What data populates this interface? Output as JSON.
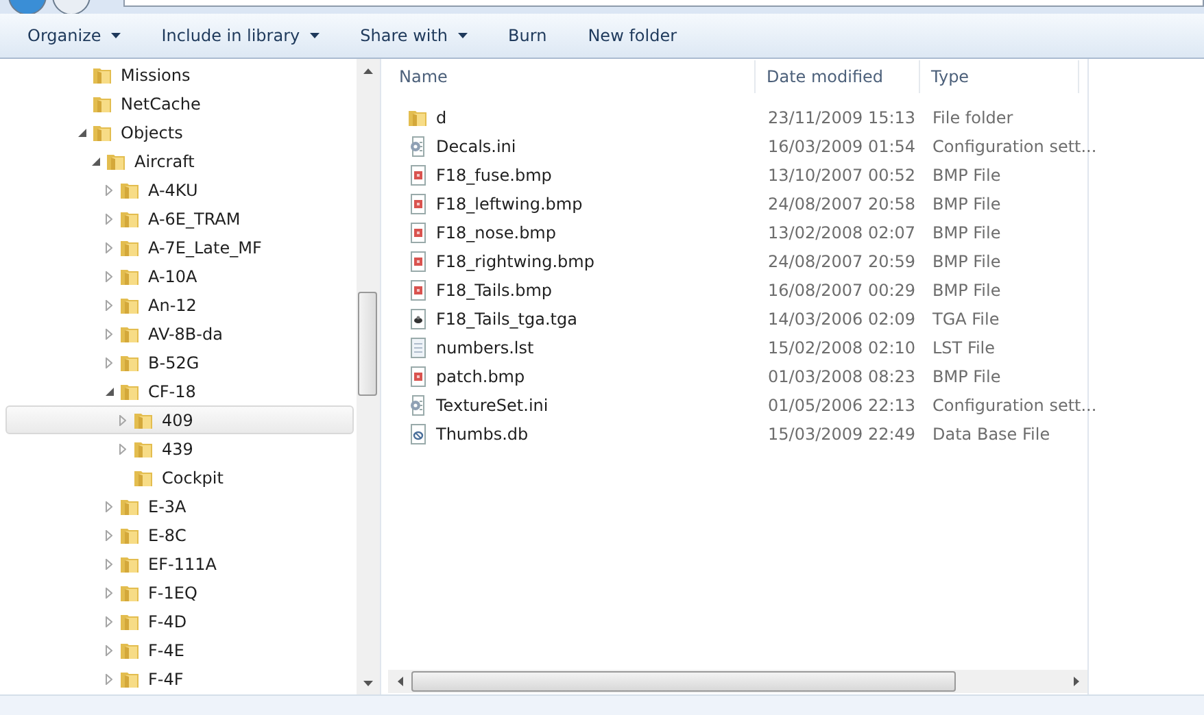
{
  "toolbar": [
    {
      "label": "Organize",
      "dropdown": true
    },
    {
      "label": "Include in library",
      "dropdown": true
    },
    {
      "label": "Share with",
      "dropdown": true
    },
    {
      "label": "Burn",
      "dropdown": false
    },
    {
      "label": "New folder",
      "dropdown": false
    }
  ],
  "tree": [
    {
      "label": "Missions",
      "selected": false
    },
    {
      "label": "NetCache",
      "selected": false
    },
    {
      "label": "Objects",
      "selected": false,
      "expanded": true,
      "children": [
        {
          "label": "Aircraft",
          "selected": false,
          "expanded": true,
          "children": [
            {
              "label": "A-4KU",
              "selected": false,
              "expanded": false
            },
            {
              "label": "A-6E_TRAM",
              "selected": false,
              "expanded": false
            },
            {
              "label": "A-7E_Late_MF",
              "selected": false,
              "expanded": false
            },
            {
              "label": "A-10A",
              "selected": false,
              "expanded": false
            },
            {
              "label": "An-12",
              "selected": false,
              "expanded": false
            },
            {
              "label": "AV-8B-da",
              "selected": false,
              "expanded": false
            },
            {
              "label": "B-52G",
              "selected": false,
              "expanded": false
            },
            {
              "label": "CF-18",
              "selected": false,
              "expanded": true,
              "children": [
                {
                  "label": "409",
                  "selected": true,
                  "expanded": false
                },
                {
                  "label": "439",
                  "selected": false,
                  "expanded": false
                },
                {
                  "label": "Cockpit",
                  "selected": false
                }
              ]
            },
            {
              "label": "E-3A",
              "selected": false,
              "expanded": false
            },
            {
              "label": "E-8C",
              "selected": false,
              "expanded": false
            },
            {
              "label": "EF-111A",
              "selected": false,
              "expanded": false
            },
            {
              "label": "F-1EQ",
              "selected": false,
              "expanded": false
            },
            {
              "label": "F-4D",
              "selected": false,
              "expanded": false
            },
            {
              "label": "F-4E",
              "selected": false,
              "expanded": false
            },
            {
              "label": "F-4F",
              "selected": false,
              "expanded": false
            }
          ]
        }
      ]
    }
  ],
  "columns": [
    "Name",
    "Date modified",
    "Type"
  ],
  "files": [
    {
      "kind": "folder",
      "name": "d",
      "date": "23/11/2009 15:13",
      "type": "File folder"
    },
    {
      "kind": "config",
      "name": "Decals.ini",
      "date": "16/03/2009 01:54",
      "type": "Configuration sett..."
    },
    {
      "kind": "image",
      "name": "F18_fuse.bmp",
      "date": "13/10/2007 00:52",
      "type": "BMP File"
    },
    {
      "kind": "image",
      "name": "F18_leftwing.bmp",
      "date": "24/08/2007 20:58",
      "type": "BMP File"
    },
    {
      "kind": "image",
      "name": "F18_nose.bmp",
      "date": "13/02/2008 02:07",
      "type": "BMP File"
    },
    {
      "kind": "image",
      "name": "F18_rightwing.bmp",
      "date": "24/08/2007 20:59",
      "type": "BMP File"
    },
    {
      "kind": "image",
      "name": "F18_Tails.bmp",
      "date": "16/08/2007 00:29",
      "type": "BMP File"
    },
    {
      "kind": "tga",
      "name": "F18_Tails_tga.tga",
      "date": "14/03/2006 02:09",
      "type": "TGA File"
    },
    {
      "kind": "text",
      "name": "numbers.lst",
      "date": "15/02/2008 02:10",
      "type": "LST File"
    },
    {
      "kind": "image",
      "name": "patch.bmp",
      "date": "01/03/2008 08:23",
      "type": "BMP File"
    },
    {
      "kind": "config",
      "name": "TextureSet.ini",
      "date": "01/05/2006 22:13",
      "type": "Configuration sett..."
    },
    {
      "kind": "db",
      "name": "Thumbs.db",
      "date": "15/03/2009 22:49",
      "type": "Data Base File"
    }
  ]
}
